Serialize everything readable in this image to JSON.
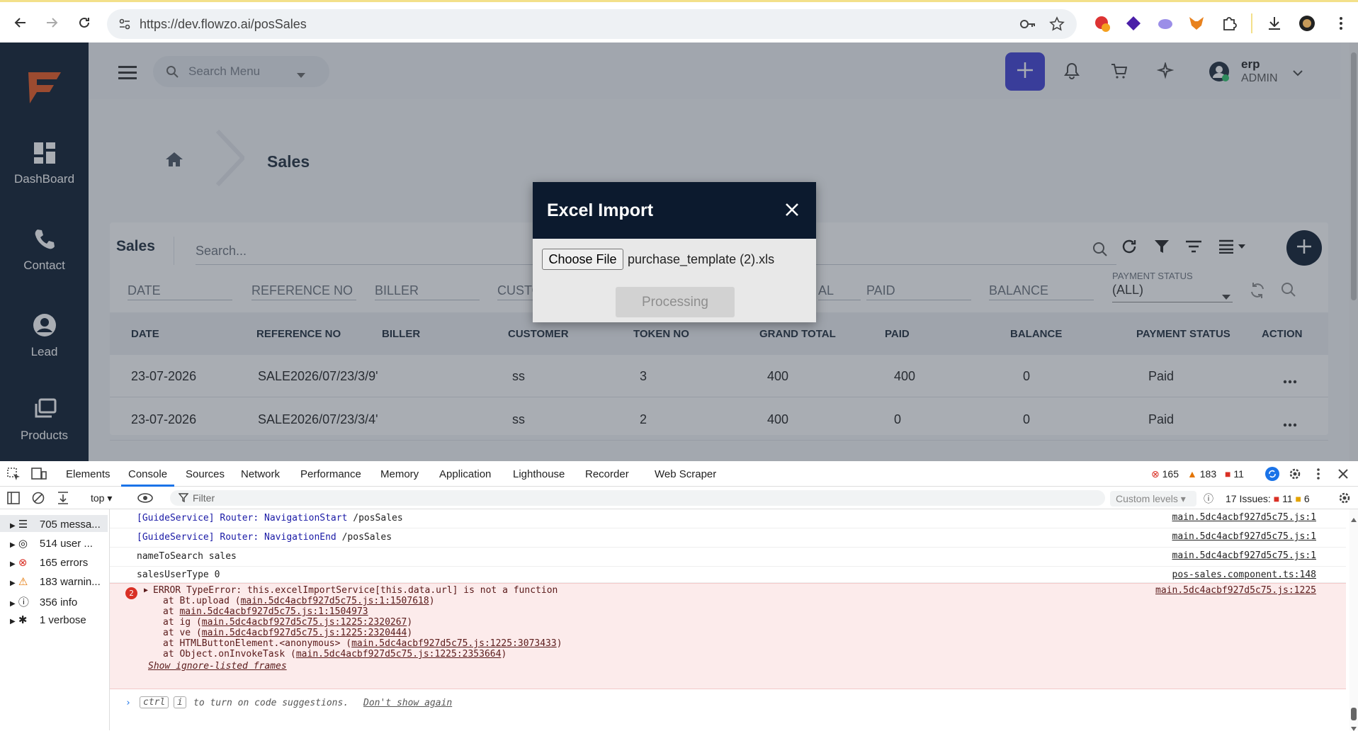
{
  "browser": {
    "url": "https://dev.flowzo.ai/posSales"
  },
  "sidebar": {
    "items": [
      {
        "label": "DashBoard",
        "icon": "dashboard-icon"
      },
      {
        "label": "Contact",
        "icon": "phone-icon"
      },
      {
        "label": "Lead",
        "icon": "person-icon"
      },
      {
        "label": "Products",
        "icon": "products-icon"
      }
    ]
  },
  "topbar": {
    "search_placeholder": "Search Menu",
    "user_name": "erp",
    "user_role": "ADMIN"
  },
  "page": {
    "title": "Sales"
  },
  "card": {
    "title": "Sales",
    "search_placeholder": "Search...",
    "filters": [
      "DATE",
      "REFERENCE NO",
      "BILLER",
      "CUSTO",
      "AL",
      "PAID",
      "BALANCE"
    ],
    "payment_status_label": "PAYMENT STATUS",
    "payment_status_value": "(ALL)",
    "columns": [
      "DATE",
      "REFERENCE NO",
      "BILLER",
      "CUSTOMER",
      "TOKEN NO",
      "GRAND TOTAL",
      "PAID",
      "BALANCE",
      "PAYMENT STATUS",
      "ACTION"
    ],
    "rows": [
      {
        "date": "23-07-2026",
        "ref": "SALE2026/07/23/3/9'",
        "customer": "ss",
        "token": "3",
        "total": "400",
        "paid": "400",
        "balance": "0",
        "status": "Paid"
      },
      {
        "date": "23-07-2026",
        "ref": "SALE2026/07/23/3/4'",
        "customer": "ss",
        "token": "2",
        "total": "400",
        "paid": "0",
        "balance": "0",
        "status": "Paid"
      }
    ]
  },
  "modal": {
    "title": "Excel Import",
    "choose_file_label": "Choose File",
    "file_name": "purchase_template (2).xls",
    "processing_label": "Processing"
  },
  "devtools": {
    "tabs": [
      "Elements",
      "Console",
      "Sources",
      "Network",
      "Performance",
      "Memory",
      "Application",
      "Lighthouse",
      "Recorder",
      "Web Scraper"
    ],
    "error_count": "165",
    "warning_count": "183",
    "issue_count_top": "11",
    "context": "top",
    "filter_placeholder": "Filter",
    "levels": "Custom levels",
    "issues_label": "17 Issues:",
    "issues_err": "11",
    "issues_info": "6",
    "side": [
      {
        "label": "705 messa...",
        "icon": "list-icon"
      },
      {
        "label": "514 user ...",
        "icon": "user-icon"
      },
      {
        "label": "165 errors",
        "icon": "error-icon"
      },
      {
        "label": "183 warnin...",
        "icon": "warning-icon"
      },
      {
        "label": "356 info",
        "icon": "info-icon"
      },
      {
        "label": "1 verbose",
        "icon": "bug-icon"
      }
    ],
    "messages": [
      {
        "prefix": "[GuideService] Router: NavigationStart",
        "text": "/posSales",
        "src": "main.5dc4acbf927d5c75.js:1"
      },
      {
        "prefix": "[GuideService] Router: NavigationEnd",
        "text": "/posSales",
        "src": "main.5dc4acbf927d5c75.js:1"
      },
      {
        "prefix": "",
        "text": "nameToSearch sales",
        "src": "main.5dc4acbf927d5c75.js:1"
      },
      {
        "prefix": "",
        "text": "salesUserType 0",
        "src": "pos-sales.component.ts:148"
      }
    ],
    "error": {
      "count": "2",
      "message": "ERROR TypeError: this.excelImportService[this.data.url] is not a function",
      "src": "main.5dc4acbf927d5c75.js:1225",
      "stack": [
        {
          "pre": "at Bt.upload (",
          "link": "main.5dc4acbf927d5c75.js:1:1507618",
          "post": ")"
        },
        {
          "pre": "at ",
          "link": "main.5dc4acbf927d5c75.js:1:1504973",
          "post": ""
        },
        {
          "pre": "at ig (",
          "link": "main.5dc4acbf927d5c75.js:1225:2320267",
          "post": ")"
        },
        {
          "pre": "at ve (",
          "link": "main.5dc4acbf927d5c75.js:1225:2320444",
          "post": ")"
        },
        {
          "pre": "at HTMLButtonElement.<anonymous> (",
          "link": "main.5dc4acbf927d5c75.js:1225:3073433",
          "post": ")"
        },
        {
          "pre": "at Object.onInvokeTask (",
          "link": "main.5dc4acbf927d5c75.js:1225:2353664",
          "post": ")"
        }
      ],
      "show_frames": "Show ignore-listed frames"
    },
    "hint_ctrl": "ctrl",
    "hint_key": "i",
    "hint_text": "to turn on code suggestions.",
    "hint_dismiss": "Don't show again"
  },
  "colors": {
    "sidebar": "#0c1a2e",
    "accent": "#3f3fd4",
    "error_bg": "#fcebeb"
  }
}
